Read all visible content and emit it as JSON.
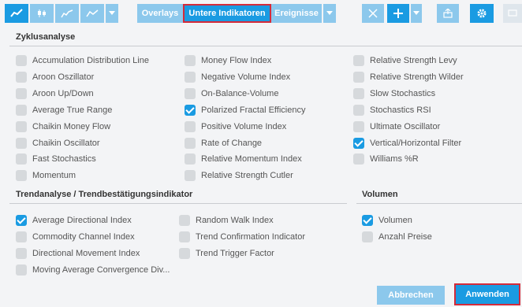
{
  "toolbar": {
    "chart_types": [
      {
        "icon": "area-chart-icon",
        "active": true
      },
      {
        "icon": "candlestick-icon",
        "active": false
      },
      {
        "icon": "line-chart-icon",
        "active": false
      },
      {
        "icon": "bar-chart-icon",
        "active": false
      }
    ],
    "tabs": [
      {
        "label": "Overlays",
        "selected": false
      },
      {
        "label": "Untere Indikatoren",
        "selected": true
      },
      {
        "label": "Ereignisse",
        "selected": false
      }
    ]
  },
  "sections": {
    "zyklus": {
      "title": "Zyklusanalyse",
      "col1": [
        {
          "label": "Accumulation Distribution Line",
          "checked": false
        },
        {
          "label": "Aroon Oszillator",
          "checked": false
        },
        {
          "label": "Aroon Up/Down",
          "checked": false
        },
        {
          "label": "Average True Range",
          "checked": false
        },
        {
          "label": "Chaikin Money Flow",
          "checked": false
        },
        {
          "label": "Chaikin Oscillator",
          "checked": false
        },
        {
          "label": "Fast Stochastics",
          "checked": false
        },
        {
          "label": "Momentum",
          "checked": false
        }
      ],
      "col2": [
        {
          "label": "Money Flow Index",
          "checked": false
        },
        {
          "label": "Negative Volume Index",
          "checked": false
        },
        {
          "label": "On-Balance-Volume",
          "checked": false
        },
        {
          "label": "Polarized Fractal Efficiency",
          "checked": true
        },
        {
          "label": "Positive Volume Index",
          "checked": false
        },
        {
          "label": "Rate of Change",
          "checked": false
        },
        {
          "label": "Relative Momentum Index",
          "checked": false
        },
        {
          "label": "Relative Strength Cutler",
          "checked": false
        }
      ],
      "col3": [
        {
          "label": "Relative Strength Levy",
          "checked": false
        },
        {
          "label": "Relative Strength Wilder",
          "checked": false
        },
        {
          "label": "Slow Stochastics",
          "checked": false
        },
        {
          "label": "Stochastics RSI",
          "checked": false
        },
        {
          "label": "Ultimate Oscillator",
          "checked": false
        },
        {
          "label": "Vertical/Horizontal Filter",
          "checked": true
        },
        {
          "label": "Williams %R",
          "checked": false
        }
      ]
    },
    "trend": {
      "title": "Trendanalyse / Trendbestätigungsindikator",
      "col1": [
        {
          "label": "Average Directional Index",
          "checked": true
        },
        {
          "label": "Commodity Channel Index",
          "checked": false
        },
        {
          "label": "Directional Movement Index",
          "checked": false
        },
        {
          "label": "Moving Average Convergence Div...",
          "checked": false
        }
      ],
      "col2": [
        {
          "label": "Random Walk Index",
          "checked": false
        },
        {
          "label": "Trend Confirmation Indicator",
          "checked": false
        },
        {
          "label": "Trend Trigger Factor",
          "checked": false
        }
      ]
    },
    "volumen": {
      "title": "Volumen",
      "col1": [
        {
          "label": "Volumen",
          "checked": true
        },
        {
          "label": "Anzahl Preise",
          "checked": false
        }
      ]
    }
  },
  "footer": {
    "cancel_label": "Abbrechen",
    "apply_label": "Anwenden"
  },
  "colors": {
    "accent": "#1a9be2",
    "accent_light": "#8cc8ec",
    "highlight_outline": "#d42b3a",
    "checkbox_off": "#d6d9dc"
  }
}
